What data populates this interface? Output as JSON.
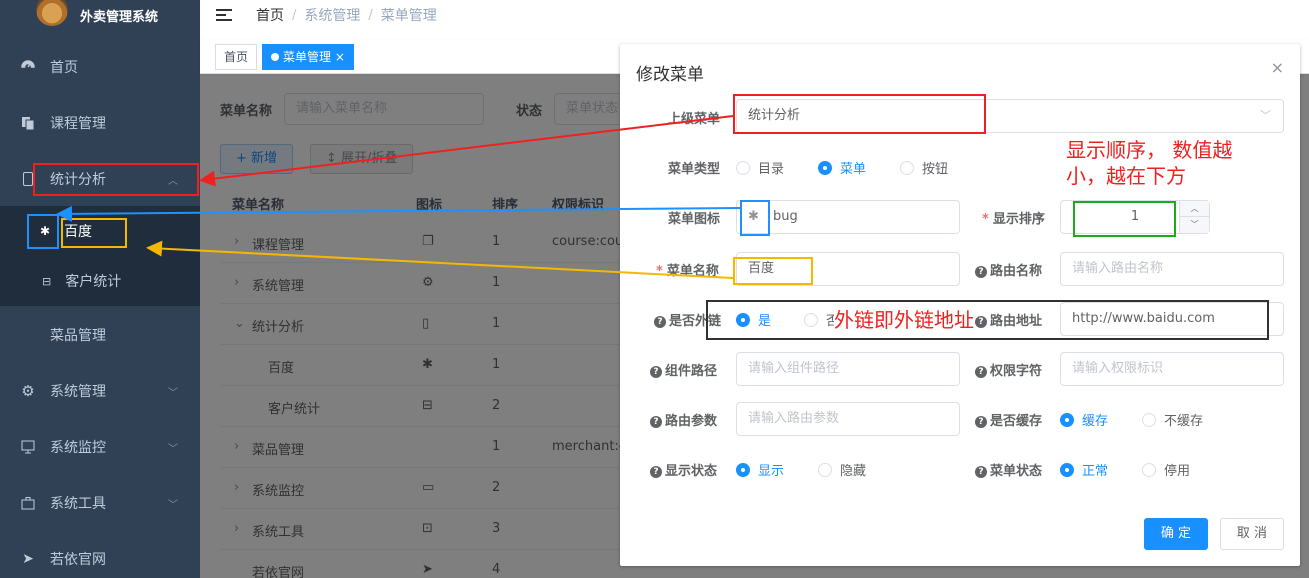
{
  "app": {
    "title": "外卖管理系统"
  },
  "sidebar": {
    "items": [
      {
        "label": "首页",
        "icon": "dashboard-icon"
      },
      {
        "label": "课程管理",
        "icon": "copy-icon"
      },
      {
        "label": "统计分析",
        "icon": "phone-icon",
        "expanded": true,
        "children": [
          {
            "label": "百度",
            "icon": "bug-icon"
          },
          {
            "label": "客户统计",
            "icon": "tree-icon"
          }
        ]
      },
      {
        "label": "菜品管理"
      },
      {
        "label": "系统管理",
        "icon": "gear-icon"
      },
      {
        "label": "系统监控",
        "icon": "monitor-icon"
      },
      {
        "label": "系统工具",
        "icon": "toolbox-icon"
      },
      {
        "label": "若依官网",
        "icon": "send-icon"
      }
    ]
  },
  "breadcrumb": [
    "首页",
    "系统管理",
    "菜单管理"
  ],
  "tags": [
    {
      "label": "首页"
    },
    {
      "label": "菜单管理",
      "close": "×"
    }
  ],
  "search": {
    "name_label": "菜单名称",
    "name_placeholder": "请输入菜单名称",
    "status_label": "状态",
    "status_placeholder": "菜单状态"
  },
  "toolbar": {
    "add": "+ 新增",
    "expand": "↕ 展开/折叠"
  },
  "table": {
    "headers": [
      "菜单名称",
      "图标",
      "排序",
      "权限标识"
    ],
    "rows": [
      {
        "name": "课程管理",
        "arrow": "›",
        "order": "1",
        "perm": "course:cou"
      },
      {
        "name": "系统管理",
        "arrow": "›",
        "order": "1",
        "perm": ""
      },
      {
        "name": "统计分析",
        "arrow": "⌄",
        "order": "1",
        "perm": ""
      },
      {
        "name": "百度",
        "arrow": "",
        "order": "1",
        "perm": ""
      },
      {
        "name": "客户统计",
        "arrow": "",
        "order": "2",
        "perm": ""
      },
      {
        "name": "菜品管理",
        "arrow": "›",
        "order": "1",
        "perm": "merchant:c"
      },
      {
        "name": "系统监控",
        "arrow": "›",
        "order": "2",
        "perm": ""
      },
      {
        "name": "系统工具",
        "arrow": "›",
        "order": "3",
        "perm": ""
      },
      {
        "name": "若依官网",
        "arrow": "",
        "order": "4",
        "perm": ""
      }
    ]
  },
  "dialog": {
    "title": "修改菜单",
    "close": "×",
    "parent_label": "上级菜单",
    "parent_value": "统计分析",
    "type_label": "菜单类型",
    "type_options": [
      "目录",
      "菜单",
      "按钮"
    ],
    "type_selected": 1,
    "icon_label": "菜单图标",
    "icon_value": "bug",
    "order_label": "显示排序",
    "order_value": "1",
    "name_label": "菜单名称",
    "name_value": "百度",
    "route_name_label": "路由名称",
    "route_name_placeholder": "请输入路由名称",
    "external_label": "是否外链",
    "external_options": [
      "是",
      "否"
    ],
    "external_selected": 0,
    "route_path_label": "路由地址",
    "route_path_value": "http://www.baidu.com",
    "component_label": "组件路径",
    "component_placeholder": "请输入组件路径",
    "perm_label": "权限字符",
    "perm_placeholder": "请输入权限标识",
    "query_label": "路由参数",
    "query_placeholder": "请输入路由参数",
    "cache_label": "是否缓存",
    "cache_options": [
      "缓存",
      "不缓存"
    ],
    "cache_selected": 0,
    "visible_label": "显示状态",
    "visible_options": [
      "显示",
      "隐藏"
    ],
    "visible_selected": 0,
    "status_label": "菜单状态",
    "status_options": [
      "正常",
      "停用"
    ],
    "status_selected": 0,
    "confirm": "确 定",
    "cancel": "取 消"
  },
  "annotations": {
    "order_note": "显示顺序， 数值越小，越在下方",
    "external_note": "外链即外链地址"
  },
  "colors": {
    "sidebar": "#304156",
    "primary": "#1890ff",
    "red_box": "#f02020",
    "blue_box": "#1e90ff",
    "yellow_box": "#f5b800",
    "green_box": "#1aad19",
    "dark_box": "#303133"
  }
}
